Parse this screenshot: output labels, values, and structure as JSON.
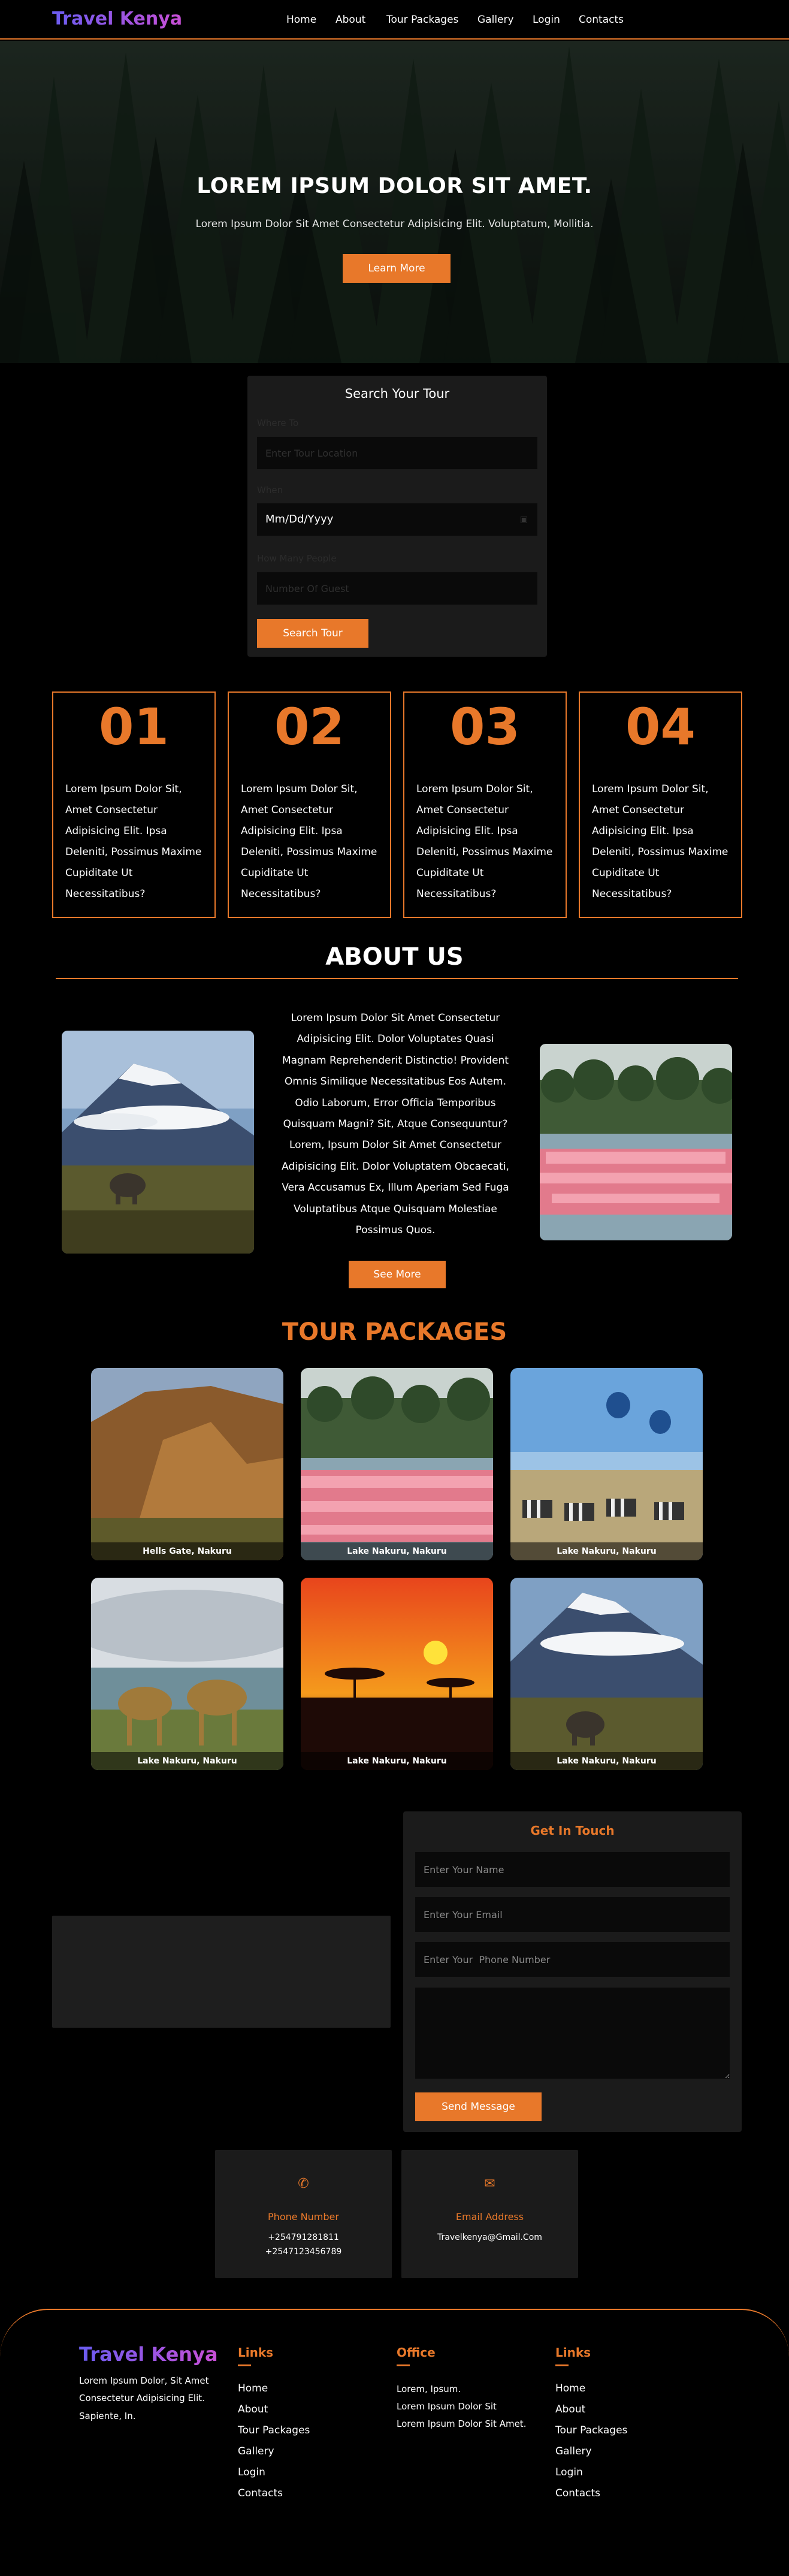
{
  "nav": {
    "brand": "Travel Kenya",
    "links": [
      "Home",
      "About",
      "Tour Packages",
      "Gallery",
      "Login",
      "Contacts"
    ]
  },
  "hero": {
    "title": "LOREM IPSUM DOLOR SIT AMET.",
    "subtitle": "Lorem Ipsum Dolor Sit Amet Consectetur Adipisicing Elit. Voluptatum, Mollitia.",
    "button": "Learn More"
  },
  "search": {
    "title": "Search Your Tour",
    "where_label": "Where To",
    "where_placeholder": "Enter Tour Location",
    "when_label": "When",
    "when_value": "Mm/Dd/Yyyy",
    "people_label": "How Many People",
    "people_placeholder": "Number Of Guest",
    "button": "Search Tour"
  },
  "steps": [
    {
      "num": "01",
      "text": "Lorem Ipsum Dolor Sit, Amet Consectetur Adipisicing Elit. Ipsa Deleniti, Possimus Maxime Cupiditate Ut Necessitatibus?"
    },
    {
      "num": "02",
      "text": "Lorem Ipsum Dolor Sit, Amet Consectetur Adipisicing Elit. Ipsa Deleniti, Possimus Maxime Cupiditate Ut Necessitatibus?"
    },
    {
      "num": "03",
      "text": "Lorem Ipsum Dolor Sit, Amet Consectetur Adipisicing Elit. Ipsa Deleniti, Possimus Maxime Cupiditate Ut Necessitatibus?"
    },
    {
      "num": "04",
      "text": "Lorem Ipsum Dolor Sit, Amet Consectetur Adipisicing Elit. Ipsa Deleniti, Possimus Maxime Cupiditate Ut Necessitatibus?"
    }
  ],
  "about": {
    "title": "ABOUT US",
    "text": "Lorem Ipsum Dolor Sit Amet Consectetur Adipisicing Elit. Dolor Voluptates Quasi Magnam Reprehenderit Distinctio! Provident Omnis Similique Necessitatibus Eos Autem. Odio Laborum, Error Officia Temporibus Quisquam Magni? Sit, Atque Consequuntur? Lorem, Ipsum Dolor Sit Amet Consectetur Adipisicing Elit. Dolor Voluptatem Obcaecati, Vera Accusamus Ex, Illum Aperiam Sed Fuga Voluptatibus Atque Quisquam Molestiae Possimus Quos.",
    "button": "See More"
  },
  "packages": {
    "title": "TOUR PACKAGES",
    "cards": [
      {
        "caption": "Hells Gate, Nakuru",
        "icon": "gorge-photo"
      },
      {
        "caption": "Lake Nakuru, Nakuru",
        "icon": "flamingo-photo"
      },
      {
        "caption": "Lake Nakuru, Nakuru",
        "icon": "balloon-zebra-photo"
      },
      {
        "caption": "Lake Nakuru, Nakuru",
        "icon": "camel-photo"
      },
      {
        "caption": "Lake Nakuru, Nakuru",
        "icon": "sunset-photo"
      },
      {
        "caption": "Lake Nakuru, Nakuru",
        "icon": "kilimanjaro-photo"
      }
    ]
  },
  "contact_form": {
    "title": "Get In Touch",
    "name_placeholder": "Enter Your Name",
    "email_placeholder": "Enter Your Email",
    "phone_placeholder": "Enter Your  Phone Number",
    "button": "Send Message"
  },
  "info": {
    "phone": {
      "title": "Phone Number",
      "lines": [
        "+254791281811",
        "+2547123456789"
      ],
      "icon": "phone-icon"
    },
    "email": {
      "title": "Email Address",
      "lines": [
        "Travelkenya@Gmail.Com"
      ],
      "icon": "envelope-icon"
    }
  },
  "footer": {
    "brand": "Travel Kenya",
    "desc": [
      "Lorem Ipsum Dolor, Sit Amet",
      "Consectetur Adipisicing Elit.",
      "Sapiente, In."
    ],
    "links_title": "Links",
    "links": [
      "Home",
      "About",
      "Tour Packages",
      "Gallery",
      "Login",
      "Contacts"
    ],
    "office_title": "Office",
    "office": [
      "Lorem, Ipsum.",
      "Lorem Ipsum Dolor Sit",
      "Lorem Ipsum Dolor Sit Amet."
    ],
    "links2_title": "Links",
    "links2": [
      "Home",
      "About",
      "Tour Packages",
      "Gallery",
      "Login",
      "Contacts"
    ]
  },
  "colors": {
    "accent": "#e8782a",
    "brand_start": "#6a5cf0",
    "brand_end": "#c94fd6",
    "panel": "#1b1b1b"
  }
}
